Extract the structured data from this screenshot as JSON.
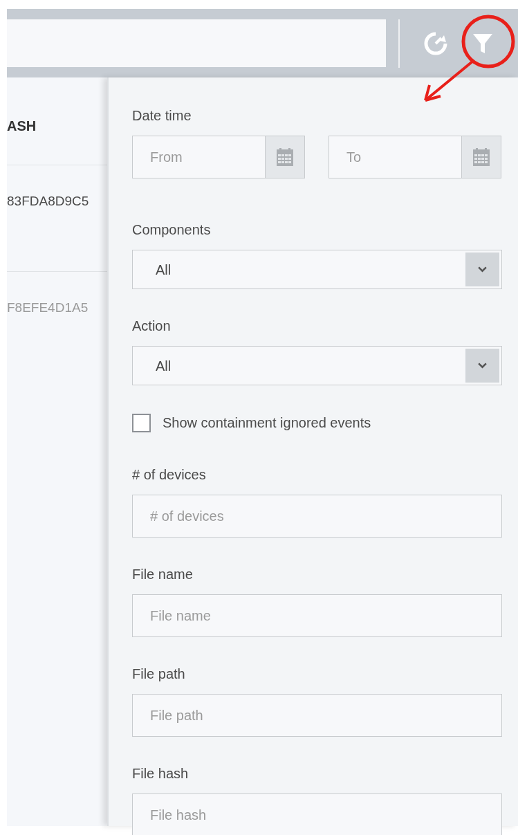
{
  "table": {
    "header": "ASH",
    "rows": [
      {
        "text": "83FDA8D9C5",
        "dimmed": false
      },
      {
        "text": "F8EFE4D1A5",
        "dimmed": true
      }
    ]
  },
  "filter_panel": {
    "fields": [
      {
        "kind": "date_range",
        "label": "Date time",
        "from_placeholder": "From",
        "to_placeholder": "To"
      },
      {
        "kind": "select",
        "label": "Components",
        "value": "All"
      },
      {
        "kind": "select",
        "label": "Action",
        "value": "All"
      },
      {
        "kind": "checkbox",
        "label": "Show containment ignored events",
        "checked": false
      },
      {
        "kind": "text",
        "label": "# of devices",
        "placeholder": "# of devices"
      },
      {
        "kind": "text",
        "label": "File name",
        "placeholder": "File name"
      },
      {
        "kind": "text",
        "label": "File path",
        "placeholder": "File path"
      },
      {
        "kind": "text",
        "label": "File hash",
        "placeholder": "File hash"
      }
    ]
  }
}
